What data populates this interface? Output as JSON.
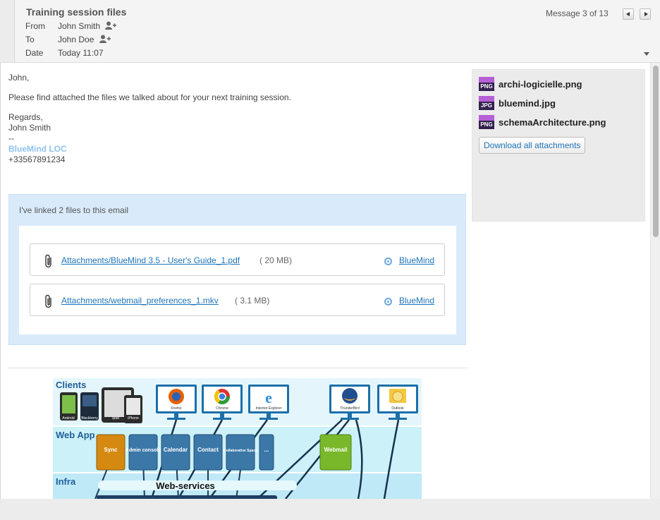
{
  "header": {
    "subject": "Training session files",
    "from_label": "From",
    "from_value": "John Smith",
    "to_label": "To",
    "to_value": "John Doe",
    "date_label": "Date",
    "date_value": "Today 11:07",
    "message_counter": "Message 3 of 13"
  },
  "body": {
    "greeting": "John,",
    "line1": "Please find attached the files we talked about for your next training session.",
    "closing": "Regards,",
    "sender": "John Smith",
    "sig_sep": "--",
    "sig_company": "BlueMind LOC",
    "sig_phone": "+33567891234"
  },
  "linked_files": {
    "title": "I've linked 2 files to this email",
    "items": [
      {
        "name": "Attachments/BlueMind 3.5 - User's Guide_1.pdf",
        "size": "( 20 MB)",
        "provider": "BlueMind"
      },
      {
        "name": "Attachments/webmail_preferences_1.mkv",
        "size": "( 3.1 MB)",
        "provider": "BlueMind"
      }
    ]
  },
  "attachments": {
    "items": [
      {
        "ext": "PNG",
        "name": "archi-logicielle.png"
      },
      {
        "ext": "JPG",
        "name": "bluemind.jpg"
      },
      {
        "ext": "PNG",
        "name": "schemaArchitecture.png"
      }
    ],
    "download_all_label": "Download all attachments"
  },
  "diagram": {
    "sections": {
      "clients": "Clients",
      "webapp": "Web App",
      "infra": "Infra"
    },
    "devices": [
      "Android",
      "Blackberry",
      "Ipad",
      "iPhone"
    ],
    "browsers": [
      "Firefox",
      "Chrome",
      "Internet Explorer"
    ],
    "mail_clients": [
      "ThunderBird",
      "Outlook"
    ],
    "apps": [
      "Sync",
      "Admin console",
      "Calendar",
      "Contact",
      "Collaborative Space",
      "...",
      "Webmail"
    ],
    "infra_label": "Web-services",
    "colors": {
      "bg": "#bfe9f6",
      "app_blue": "#3b78a8",
      "sync": "#d68910",
      "webmail": "#79b82a"
    }
  }
}
